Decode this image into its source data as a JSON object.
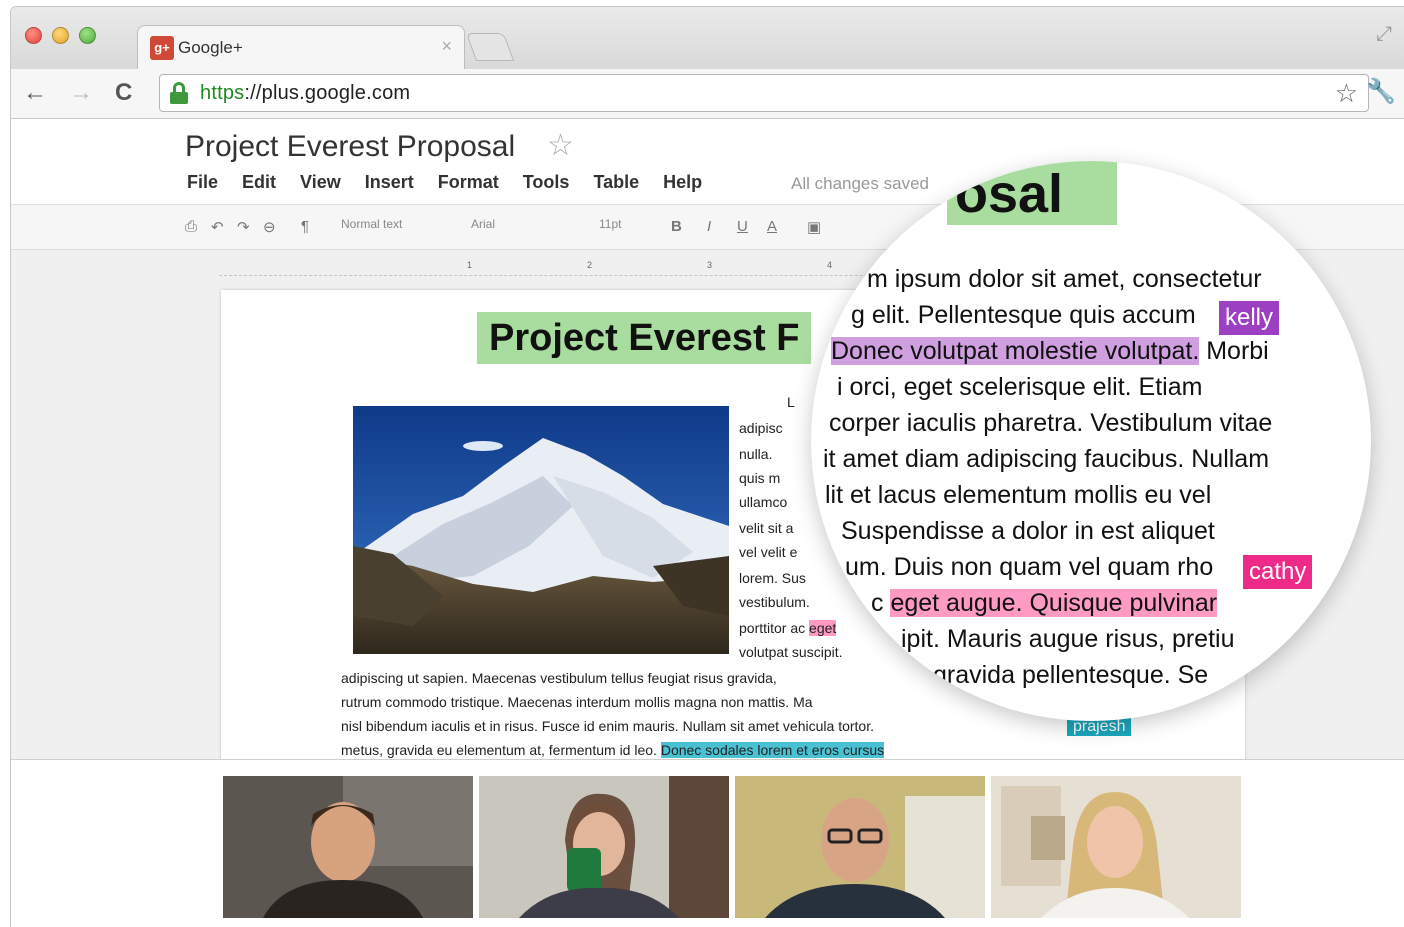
{
  "browser": {
    "tab_title": "Google+",
    "tab_favicon_text": "g+",
    "tab_close": "×",
    "url_scheme": "https",
    "url_rest": "://plus.google.com",
    "back": "←",
    "forward": "→",
    "reload": "C"
  },
  "doc": {
    "title": "Project Everest Proposal",
    "menu": [
      "File",
      "Edit",
      "View",
      "Insert",
      "Format",
      "Tools",
      "Table",
      "Help"
    ],
    "save_status": "All changes saved",
    "toolbar": {
      "style": "Normal text",
      "font": "Arial",
      "size": "11pt"
    },
    "heading": "Project Everest F",
    "body_lines": [
      "adipiscing ut sapien. Maecenas vestibulum tellus feugiat risus gravida,",
      "rutrum commodo tristique. Maecenas interdum mollis magna non mattis. Ma",
      "nisl bibendum iaculis et in risus. Fusce id enim mauris. Nullam sit amet vehicula tortor.",
      "metus, gravida eu elementum at, fermentum id leo."
    ],
    "body_tail_highlight": "Donec sodales lorem et eros cursus",
    "side_fragments": [
      "L",
      "adipisc",
      "nulla.",
      "quis m",
      "ullamco",
      "velit sit a",
      "vel velit e",
      "lorem. Sus",
      "vestibulum.",
      "porttitor ac",
      "volutpat suscipit."
    ],
    "side_pink": "eget",
    "collaborator_prajesh": "prajesh"
  },
  "magnifier": {
    "title_fragment": "osal",
    "lines": [
      "m ipsum dolor sit amet, consectetur",
      "g elit. Pellentesque quis accum",
      "Morbi",
      "i orci, eget scelerisque elit. Etiam",
      "corper iaculis pharetra. Vestibulum vitae",
      "it amet diam adipiscing faucibus. Nullam",
      "lit et lacus elementum mollis eu vel",
      "Suspendisse a dolor in est aliquet",
      "um. Duis non quam vel quam rho",
      "ipit. Mauris augue risus, pretiu",
      "gravida pellentesque. Se"
    ],
    "purple_highlight": "Donec volutpat molestie volutpat.",
    "pink_highlight": "eget augue. Quisque pulvinar",
    "pink_prefix": "c",
    "collaborator_kelly": "kelly",
    "collaborator_cathy": "cathy",
    "colors": {
      "kelly": "#9c3fc1",
      "cathy": "#ee2a89",
      "prajesh": "#1aa7bd",
      "heading_bg": "#a9dd9f"
    }
  }
}
